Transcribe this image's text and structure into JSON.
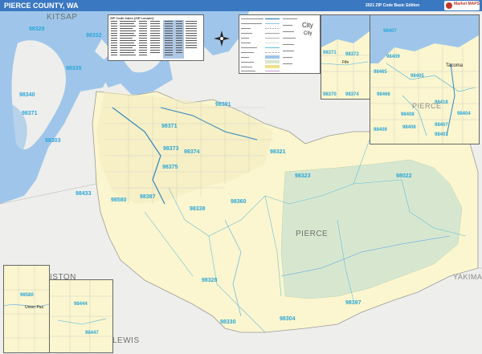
{
  "header": {
    "title": "PIERCE COUNTY, WA",
    "edition": "2021 ZIP Code Basic Edition",
    "logo_text": "Market MAPS",
    "colors": {
      "bar": "#3b78c2",
      "water": "#9fc6ea",
      "county": "#fbf6cf",
      "park": "#d7e7cf",
      "zip_label": "#2aa6d8"
    }
  },
  "map": {
    "region_labels": [
      "KITSAP",
      "PIERCE",
      "LEWIS",
      "YAKIMA",
      "ISTON"
    ],
    "zip_labels": [
      "98329",
      "98332",
      "98335",
      "98340",
      "98371",
      "98303",
      "98391",
      "98371",
      "98373",
      "98374",
      "98375",
      "98321",
      "98323",
      "98022",
      "98433",
      "98580",
      "98387",
      "98338",
      "98360",
      "98328",
      "98330",
      "98304",
      "98397",
      "98422",
      "98424",
      "98444",
      "98445",
      "98446",
      "98447"
    ],
    "inset_labels": {
      "ne_left": [
        "98371",
        "98372",
        "98370",
        "98374"
      ],
      "ne_right": [
        "98407",
        "98409",
        "98405",
        "98465",
        "98466",
        "98408",
        "98404",
        "98418",
        "98409",
        "98407",
        "98406",
        "98403"
      ],
      "sw_left": [
        "98580"
      ],
      "sw_right": [
        "98444",
        "98447"
      ]
    },
    "city_labels": [
      "Tacoma",
      "Fife",
      "Union Pas"
    ],
    "inset_region_label": "PIERCE",
    "compass_icon": "compass-rose-icon"
  },
  "zip_list_inset": {
    "title": "ZIP Code Index (ZIP Locator)",
    "rows": [
      "98022",
      "98303",
      "98304",
      "98321",
      "98323",
      "98328",
      "98329",
      "98330",
      "98332",
      "98335",
      "98338",
      "98340",
      "98360",
      "98371",
      "98372",
      "98373",
      "98374",
      "98375",
      "98387",
      "98388",
      "98390",
      "98391",
      "98397",
      "98402",
      "98403",
      "98404",
      "98405",
      "98406",
      "98407",
      "98408",
      "98409",
      "98416",
      "98418",
      "98421",
      "98422",
      "98424",
      "98430",
      "98433",
      "98438",
      "98439",
      "98443",
      "98444",
      "98445",
      "98446",
      "98447",
      "98465",
      "98466",
      "98467",
      "98498",
      "98499",
      "98580"
    ]
  },
  "legend": {
    "items": [
      {
        "label": "Interstate/Expressway",
        "color": "#2e86c1"
      },
      {
        "label": "Ramp/Interchange",
        "color": "#85c1e9"
      },
      {
        "label": "Trail",
        "color": "#555"
      },
      {
        "label": "Railroad",
        "color": "#444"
      },
      {
        "label": "County",
        "color": "#999"
      },
      {
        "label": "Zip Code",
        "color": "#bbb"
      },
      {
        "label": "ZIP Code Boundary",
        "color": "#2aa6d8"
      },
      {
        "label": "State Boundary",
        "color": "#999"
      },
      {
        "label": "Water",
        "color": "#9fc6ea"
      },
      {
        "label": "Parks/Forest",
        "color": "#d7e7cf"
      },
      {
        "label": "Urban Area",
        "color": "#f0e08a"
      },
      {
        "label": "Township/Range",
        "color": "#ccc"
      }
    ],
    "symbols": [
      {
        "label": "Major City",
        "size": "City"
      },
      {
        "label": "City",
        "size": "City"
      },
      {
        "label": "Town/Village",
        "size": "Town"
      },
      {
        "label": "Pop. 10K - 50K",
        "size": "City"
      },
      {
        "label": "Pop. 2.5K - 10K",
        "size": "City"
      },
      {
        "label": "Pop. 0 - 2.5K",
        "size": "City"
      },
      {
        "label": "County Seat",
        "size": "City"
      }
    ],
    "right_title_big": "City"
  }
}
